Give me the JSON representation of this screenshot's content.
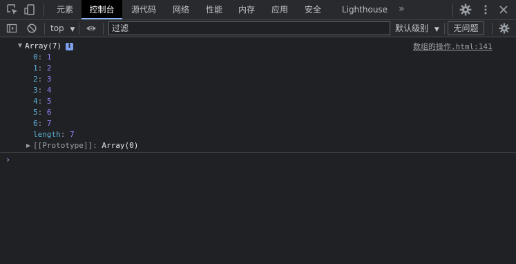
{
  "tabbar": {
    "tabs": [
      {
        "label": "元素"
      },
      {
        "label": "控制台"
      },
      {
        "label": "源代码"
      },
      {
        "label": "网络"
      },
      {
        "label": "性能"
      },
      {
        "label": "内存"
      },
      {
        "label": "应用"
      },
      {
        "label": "安全"
      },
      {
        "label": "Lighthouse"
      }
    ],
    "active_tab": "控制台",
    "more_label": "»",
    "icons": [
      "inspect-element-icon",
      "device-toolbar-icon",
      "settings-gear-icon",
      "kebab-menu-icon"
    ]
  },
  "toolbar": {
    "context": "top",
    "context_arrow": "▼",
    "filter_placeholder": "过滤",
    "levels_label": "默认级别",
    "levels_arrow": "▼",
    "issues_label": "无问题",
    "icons": [
      "sidebar-toggle-icon",
      "clear-console-icon",
      "live-expression-eye-icon",
      "console-settings-gear-icon"
    ]
  },
  "console": {
    "source_link": "数组的操作.html:141",
    "summary": "Array(7)",
    "info_badge": "i",
    "items": [
      {
        "key": "0",
        "value": "1"
      },
      {
        "key": "1",
        "value": "2"
      },
      {
        "key": "2",
        "value": "3"
      },
      {
        "key": "3",
        "value": "4"
      },
      {
        "key": "4",
        "value": "5"
      },
      {
        "key": "5",
        "value": "6"
      },
      {
        "key": "6",
        "value": "7"
      }
    ],
    "length_key": "length",
    "length_value": "7",
    "prototype_key": "[[Prototype]]",
    "prototype_value": "Array(0)",
    "prompt_symbol": "›"
  },
  "colors": {
    "background": "#202124",
    "toolbar": "#292a2d",
    "active_tab": "#000000",
    "accent": "#8ab4f8",
    "number": "#9980ff",
    "key": "#5db0d7"
  }
}
